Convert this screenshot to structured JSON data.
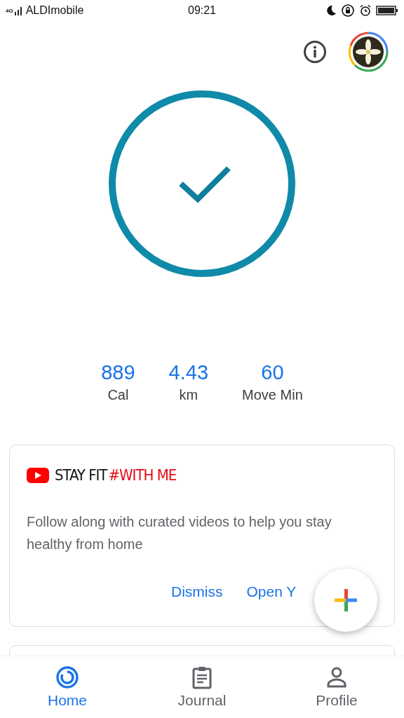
{
  "status_bar": {
    "network": "4G",
    "carrier": "ALDImobile",
    "time": "09:21"
  },
  "stats": [
    {
      "value": "889",
      "unit": "Cal"
    },
    {
      "value": "4.43",
      "unit": "km"
    },
    {
      "value": "60",
      "unit": "Move Min"
    }
  ],
  "promo_card": {
    "logo_text": "STAY FIT",
    "logo_hashtag": "#WITH ME",
    "body": "Follow along with curated videos to help you stay healthy from home",
    "actions": [
      "Dismiss",
      "Open Y"
    ]
  },
  "bottom_nav": [
    {
      "label": "Home",
      "selected": true
    },
    {
      "label": "Journal",
      "selected": false
    },
    {
      "label": "Profile",
      "selected": false
    }
  ]
}
